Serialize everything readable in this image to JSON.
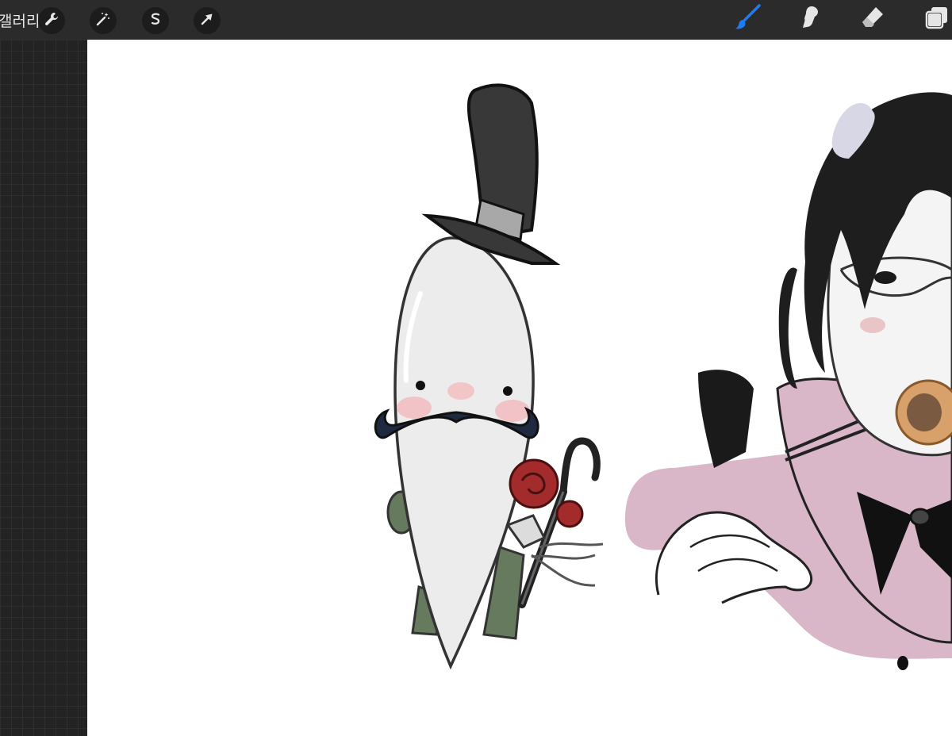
{
  "app": {
    "gallery_label": "갤러리"
  },
  "toolbar_left": {
    "icons": [
      "wrench-icon",
      "magic-wand-icon",
      "selection-icon",
      "transform-arrow-icon"
    ]
  },
  "toolbar_right": {
    "icons": [
      "brush-icon",
      "smudge-icon",
      "eraser-icon",
      "layers-icon"
    ],
    "active_tool": "brush",
    "active_color": "#1e7bf5"
  },
  "colors": {
    "toolbar_bg": "#2b2b2b",
    "canvas_bg": "#ffffff",
    "sidebar_bg": "#232323"
  }
}
